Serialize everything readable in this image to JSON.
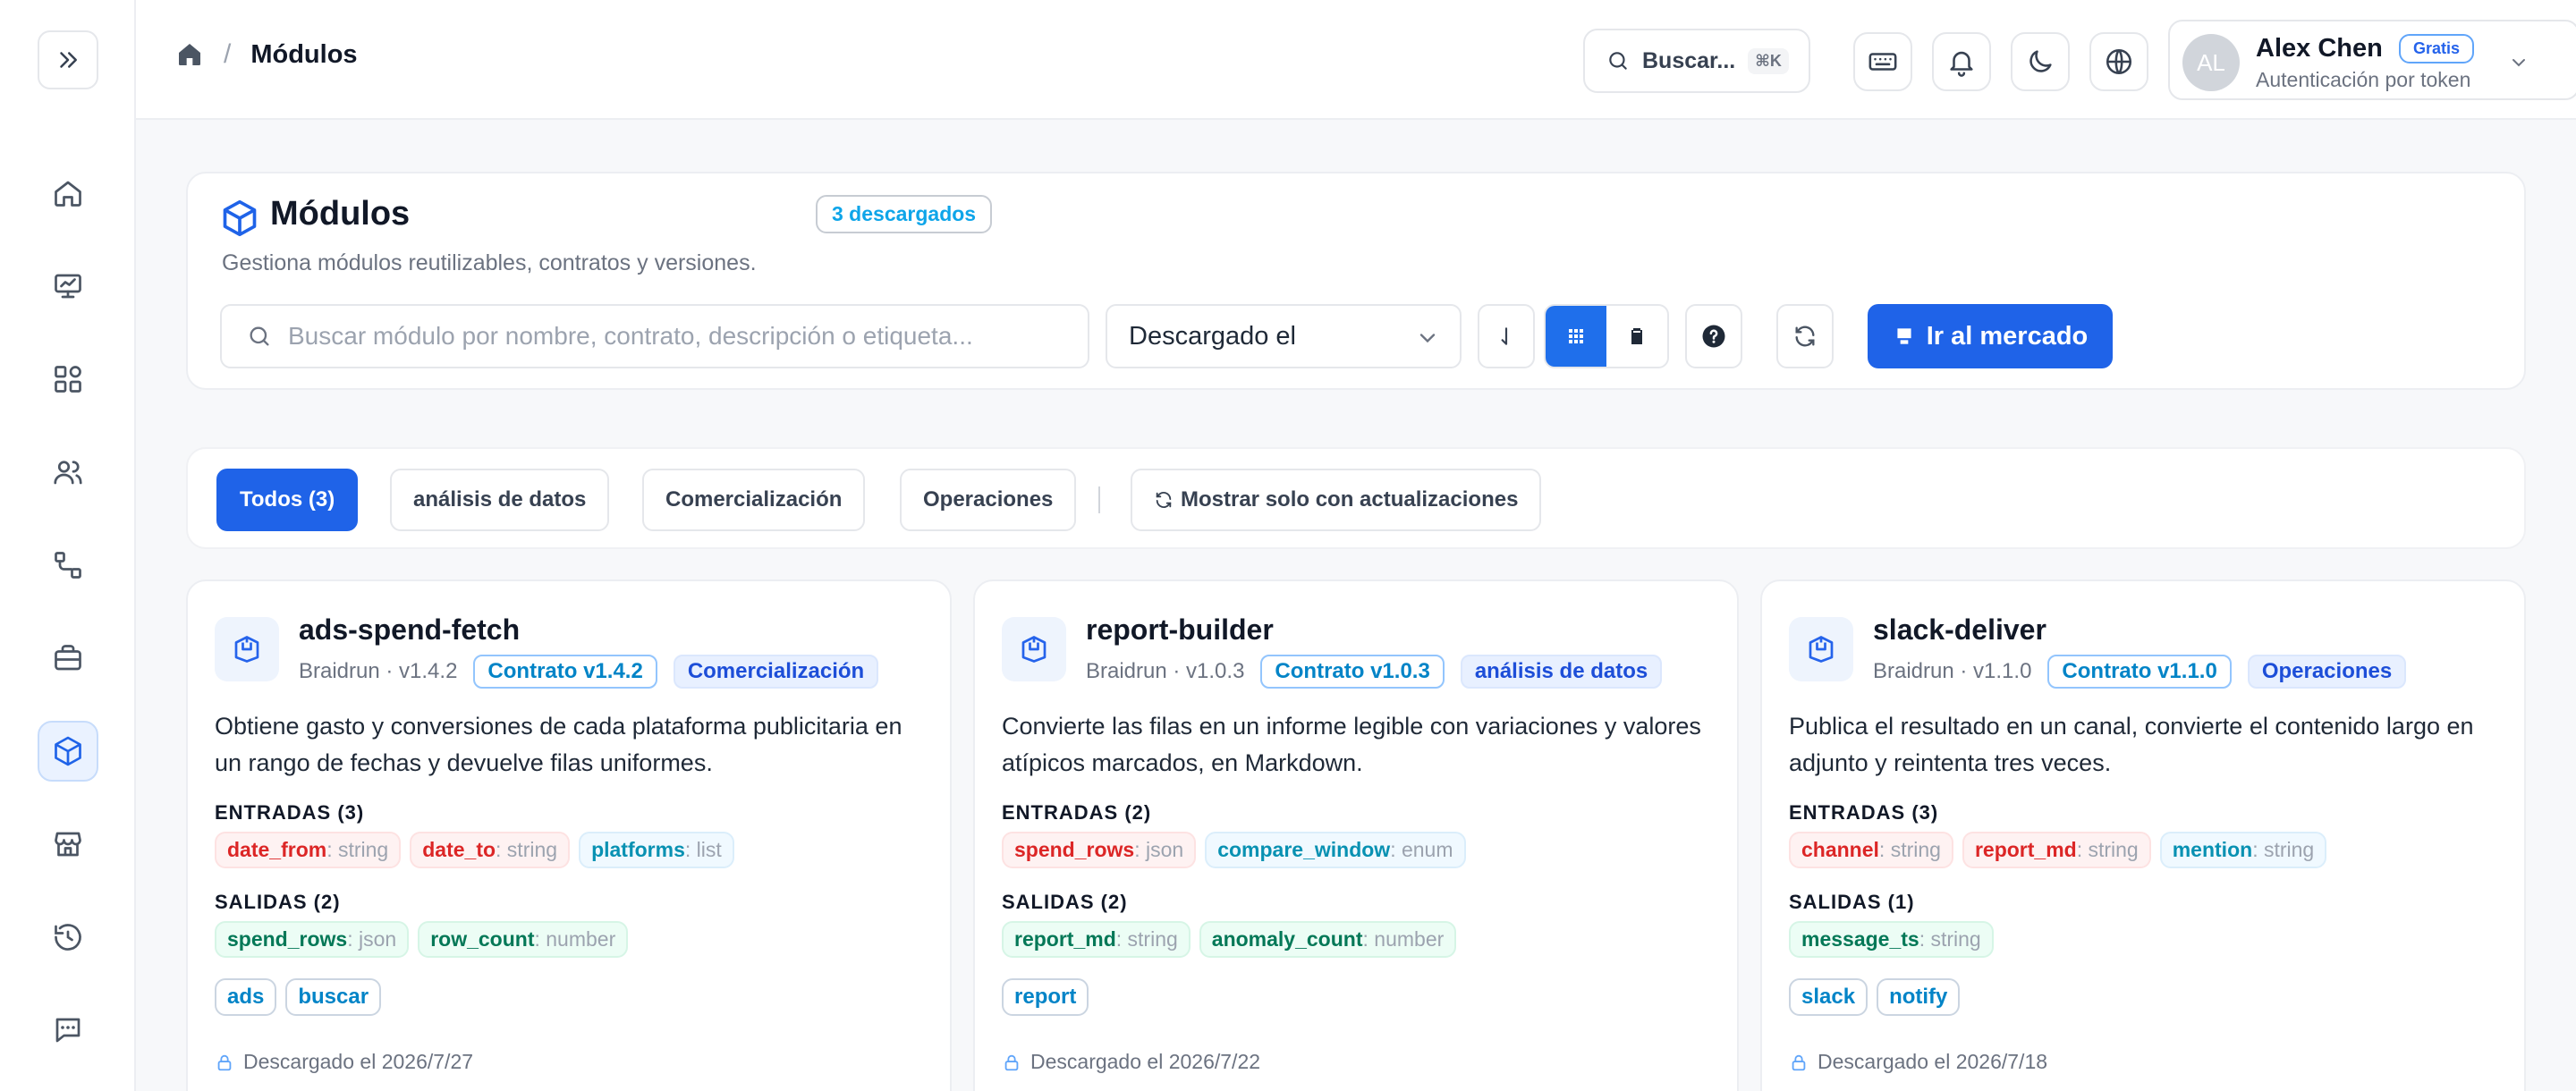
{
  "app": {
    "breadcrumb_title": "Módulos",
    "search_label": "Buscar...",
    "search_shortcut": "⌘K"
  },
  "user": {
    "initials": "AL",
    "name": "Alex Chen",
    "plan": "Gratis",
    "auth": "Autenticación por token"
  },
  "header": {
    "title": "Módulos",
    "downloaded_badge": "3 descargados",
    "subtitle": "Gestiona módulos reutilizables, contratos y versiones.",
    "search_placeholder": "Buscar módulo por nombre, contrato, descripción o etiqueta...",
    "sort_value": "Descargado el",
    "market_button": "Ir al mercado"
  },
  "filters": {
    "chips": [
      "Todos (3)",
      "análisis de datos",
      "Comercialización",
      "Operaciones"
    ],
    "updates_toggle": "Mostrar solo con actualizaciones"
  },
  "labels": {
    "inputs_prefix": "ENTRADAS",
    "outputs_prefix": "SALIDAS"
  },
  "modules": [
    {
      "name": "ads-spend-fetch",
      "meta": "Braidrun · v1.4.2",
      "contract": "Contrato v1.4.2",
      "category": "Comercialización",
      "description": "Obtiene gasto y conversiones de cada plataforma publicitaria en un rango de fechas y devuelve filas uniformes.",
      "inputs_label": "ENTRADAS (3)",
      "inputs": [
        {
          "name": "date_from",
          "type": ": string",
          "kind": "req"
        },
        {
          "name": "date_to",
          "type": ": string",
          "kind": "req"
        },
        {
          "name": "platforms",
          "type": ": list",
          "kind": "opt"
        }
      ],
      "outputs_label": "SALIDAS (2)",
      "outputs": [
        {
          "name": "spend_rows",
          "type": ": json"
        },
        {
          "name": "row_count",
          "type": ": number"
        }
      ],
      "keywords": [
        "ads",
        "buscar"
      ],
      "downloaded": "Descargado el 2026/7/27"
    },
    {
      "name": "report-builder",
      "meta": "Braidrun · v1.0.3",
      "contract": "Contrato v1.0.3",
      "category": "análisis de datos",
      "description": "Convierte las filas en un informe legible con variaciones y valores atípicos marcados, en Markdown.",
      "inputs_label": "ENTRADAS (2)",
      "inputs": [
        {
          "name": "spend_rows",
          "type": ": json",
          "kind": "req"
        },
        {
          "name": "compare_window",
          "type": ": enum",
          "kind": "opt"
        }
      ],
      "outputs_label": "SALIDAS (2)",
      "outputs": [
        {
          "name": "report_md",
          "type": ": string"
        },
        {
          "name": "anomaly_count",
          "type": ": number"
        }
      ],
      "keywords": [
        "report"
      ],
      "downloaded": "Descargado el 2026/7/22"
    },
    {
      "name": "slack-deliver",
      "meta": "Braidrun · v1.1.0",
      "contract": "Contrato v1.1.0",
      "category": "Operaciones",
      "description": "Publica el resultado en un canal, convierte el contenido largo en adjunto y reintenta tres veces.",
      "inputs_label": "ENTRADAS (3)",
      "inputs": [
        {
          "name": "channel",
          "type": ": string",
          "kind": "req"
        },
        {
          "name": "report_md",
          "type": ": string",
          "kind": "req"
        },
        {
          "name": "mention",
          "type": ": string",
          "kind": "opt"
        }
      ],
      "outputs_label": "SALIDAS (1)",
      "outputs": [
        {
          "name": "message_ts",
          "type": ": string"
        }
      ],
      "keywords": [
        "slack",
        "notify"
      ],
      "downloaded": "Descargado el 2026/7/18"
    }
  ],
  "colors": {
    "accent": "#1f63e8",
    "required": "#dc2626",
    "optional": "#0891b2",
    "output": "#047857"
  }
}
